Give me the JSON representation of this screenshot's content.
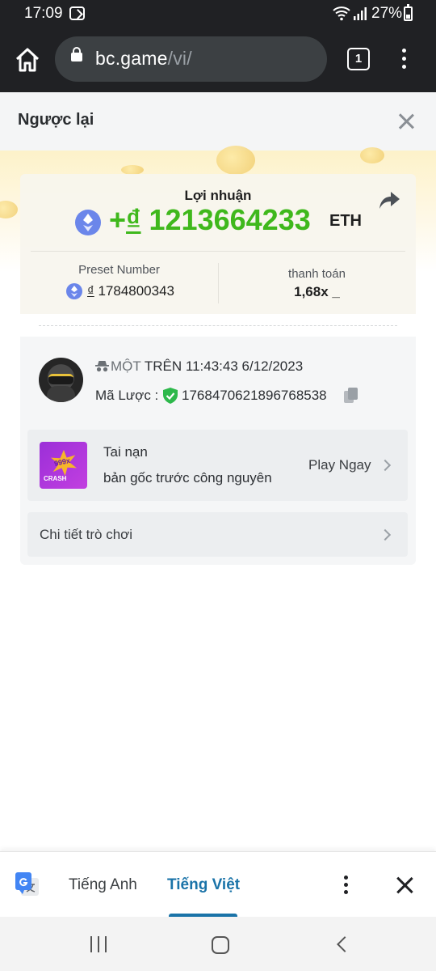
{
  "status_bar": {
    "time": "17:09",
    "battery": "27%"
  },
  "browser": {
    "url_domain": "bc.game",
    "url_path": "/vi/",
    "tab_count": "1"
  },
  "header": {
    "back_label": "Ngược lại"
  },
  "result": {
    "profit_label": "Lợi nhuận",
    "profit_sign": "+",
    "profit_symbol": "₫",
    "profit_value": " 1213664233",
    "profit_currency": "ETH",
    "preset_label": "Preset Number",
    "preset_symbol": "₫",
    "preset_value": " 1784800343",
    "payout_label": "thanh toán",
    "payout_value": "1,68x _",
    "accent_color": "#3fb81c"
  },
  "bet_info": {
    "user_name": "MỘT",
    "time_text": "TRÊN 11:43:43 6/12/2023",
    "hash_label": "Mã Lược :",
    "hash_value": "1768470621896768538"
  },
  "game": {
    "thumb_number": "999x",
    "thumb_tag": "CRASH",
    "name": "Tai nạn",
    "subtitle": "bản gốc trước công nguyên",
    "play_label": "Play Ngay"
  },
  "details": {
    "label": "Chi tiết trò chơi"
  },
  "translate_bar": {
    "lang_source": "Tiếng Anh",
    "lang_target": "Tiếng Việt"
  }
}
